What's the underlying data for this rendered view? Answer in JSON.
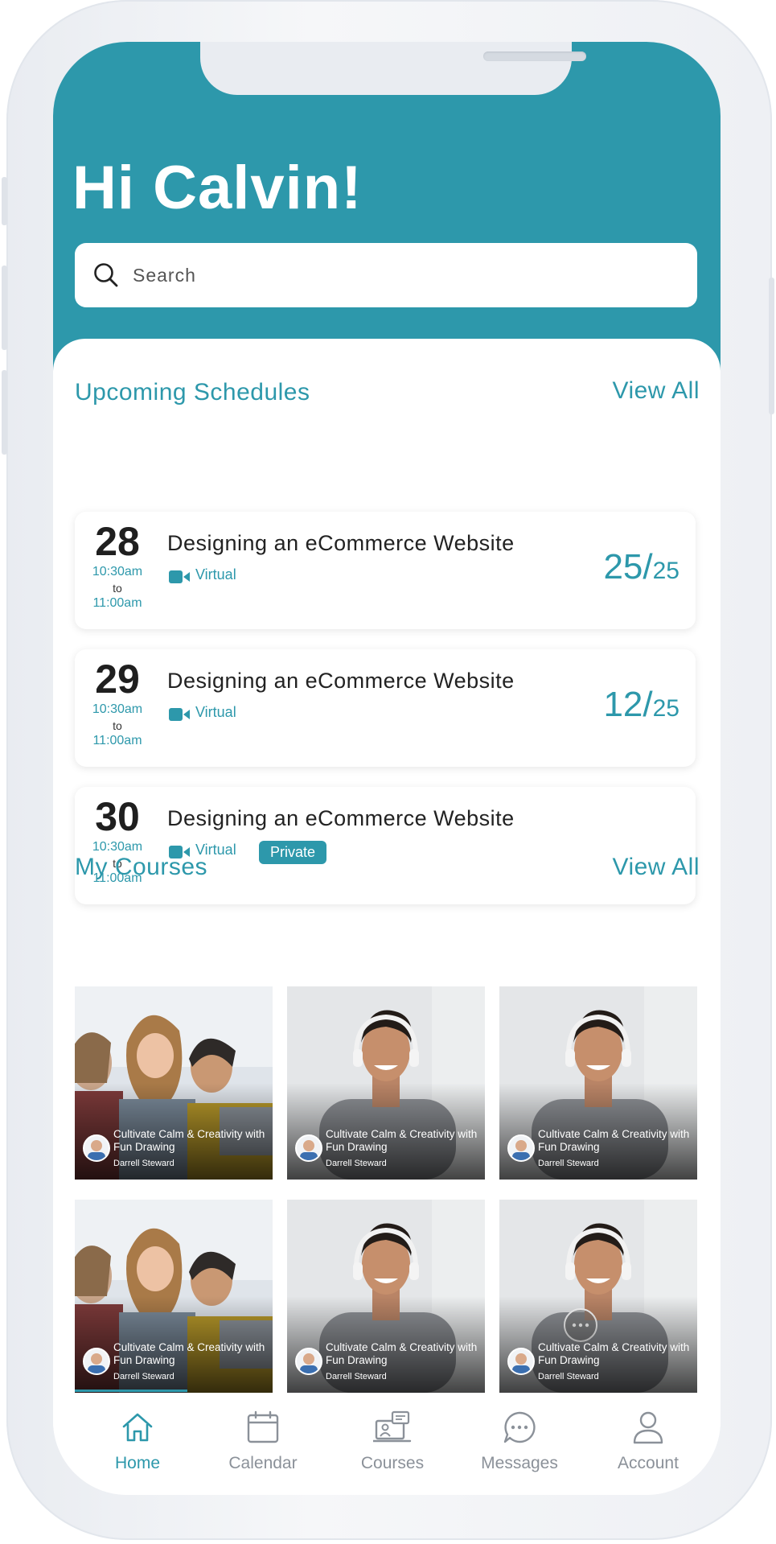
{
  "greeting": "Hi Calvin!",
  "search": {
    "placeholder": "Search"
  },
  "upcoming": {
    "title": "Upcoming Schedules",
    "view_all": "View All",
    "items": [
      {
        "day": "28",
        "start": "10:30am",
        "to": "to",
        "end": "11:00am",
        "title": "Designing an eCommerce Website",
        "mode": "Virtual",
        "count_main": "25/",
        "count_total": "25"
      },
      {
        "day": "29",
        "start": "10:30am",
        "to": "to",
        "end": "11:00am",
        "title": "Designing an eCommerce Website",
        "mode": "Virtual",
        "count_main": "12/",
        "count_total": "25"
      },
      {
        "day": "30",
        "start": "10:30am",
        "to": "to",
        "end": "11:00am",
        "title": "Designing an eCommerce Website",
        "mode": "Virtual",
        "badge": "Private"
      }
    ]
  },
  "courses": {
    "title": "My Courses",
    "view_all": "View All",
    "items": [
      {
        "title": "Cultivate Calm & Creativity with Fun Drawing",
        "author": "Darrell Steward"
      },
      {
        "title": "Cultivate Calm & Creativity with Fun Drawing",
        "author": "Darrell Steward"
      },
      {
        "title": "Cultivate Calm & Creativity with Fun Drawing",
        "author": "Darrell Steward"
      },
      {
        "title": "Cultivate Calm & Creativity with Fun Drawing",
        "author": "Darrell Steward"
      },
      {
        "title": "Cultivate Calm & Creativity with Fun Drawing",
        "author": "Darrell Steward"
      },
      {
        "title": "Cultivate Calm & Creativity with Fun Drawing",
        "author": "Darrell Steward"
      }
    ]
  },
  "tabs": [
    {
      "label": "Home",
      "icon": "home-icon"
    },
    {
      "label": "Calendar",
      "icon": "calendar-icon"
    },
    {
      "label": "Courses",
      "icon": "courses-icon"
    },
    {
      "label": "Messages",
      "icon": "messages-icon"
    },
    {
      "label": "Account",
      "icon": "account-icon"
    }
  ],
  "colors": {
    "accent": "#2d98ab",
    "tab_inactive": "#8b9199"
  }
}
